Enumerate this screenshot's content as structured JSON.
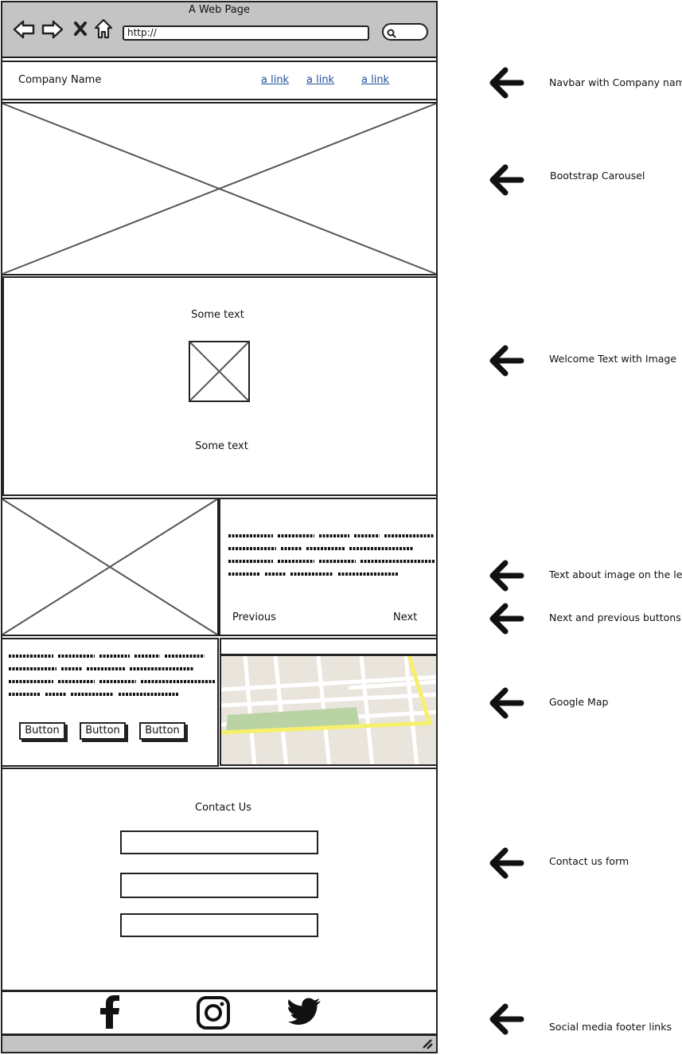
{
  "browser": {
    "title": "A Web Page",
    "url": "http://"
  },
  "navbar": {
    "company_name": "Company Name",
    "links": [
      "a link",
      "a link",
      "a link"
    ]
  },
  "welcome": {
    "text_top": "Some text",
    "text_bottom": "Some text"
  },
  "about": {
    "prev_label": "Previous",
    "next_label": "Next"
  },
  "buttons": [
    "Button",
    "Button",
    "Button"
  ],
  "contact": {
    "title": "Contact Us"
  },
  "social": {
    "icons": [
      "facebook-icon",
      "instagram-icon",
      "twitter-icon"
    ]
  },
  "annotations": [
    "Navbar with Company name",
    "Bootstrap Carousel",
    "Welcome Text with Image",
    "Text about image on the left",
    "Next and previous buttons",
    "Google Map",
    "Contact us form",
    "Social media footer links"
  ],
  "colors": {
    "chrome": "#c4c4c4",
    "link": "#1f4f9c",
    "map_bg": "#e9e5dc",
    "map_park": "#b9d3a5",
    "map_road": "#f7f06a"
  }
}
